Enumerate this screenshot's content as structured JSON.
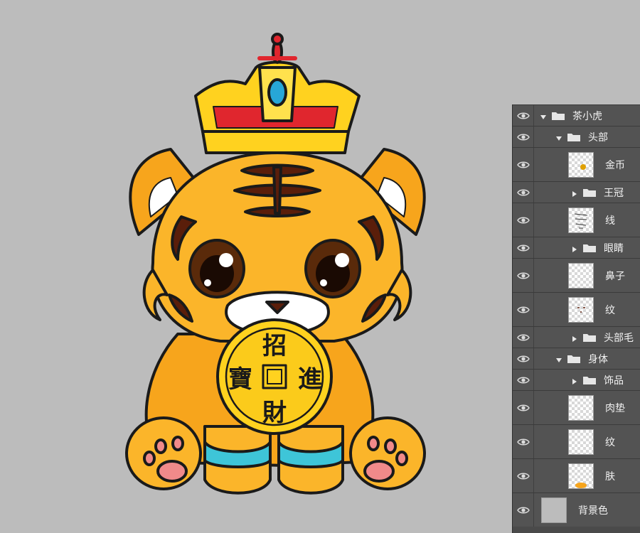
{
  "canvas": {
    "background_color": "#bcbcbc",
    "artwork": {
      "subject": "tiger cub wearing crown holding coin",
      "coin_text": {
        "top": "招",
        "bottom": "財",
        "left": "寶",
        "right": "進"
      }
    }
  },
  "layers_panel": {
    "layers": [
      {
        "label": "茶小虎",
        "type": "group",
        "expanded": true,
        "level": 0,
        "icon": "eye-icon"
      },
      {
        "label": "头部",
        "type": "group",
        "expanded": true,
        "level": 1,
        "icon": "eye-icon"
      },
      {
        "label": "金币",
        "type": "layer",
        "level": 2,
        "thumbnail": "coin-thumbnail"
      },
      {
        "label": "王冠",
        "type": "group",
        "expanded": false,
        "level": 2
      },
      {
        "label": "线",
        "type": "layer",
        "level": 2,
        "thumbnail": "lineart-thumbnail"
      },
      {
        "label": "眼睛",
        "type": "group",
        "expanded": false,
        "level": 2
      },
      {
        "label": "鼻子",
        "type": "layer",
        "level": 2,
        "thumbnail": "transparent-thumbnail"
      },
      {
        "label": "纹",
        "type": "layer",
        "level": 2,
        "thumbnail": "stripes-thumbnail"
      },
      {
        "label": "头部毛",
        "type": "group",
        "expanded": false,
        "level": 2
      },
      {
        "label": "身体",
        "type": "group",
        "expanded": true,
        "level": 1
      },
      {
        "label": "饰品",
        "type": "group",
        "expanded": false,
        "level": 2
      },
      {
        "label": "肉垫",
        "type": "layer",
        "level": 2,
        "thumbnail": "transparent-thumbnail"
      },
      {
        "label": "纹",
        "type": "layer",
        "level": 2,
        "thumbnail": "transparent-thumbnail"
      },
      {
        "label": "肤",
        "type": "layer",
        "level": 2,
        "thumbnail": "skin-thumbnail"
      },
      {
        "label": "背景色",
        "type": "layer",
        "level": 0,
        "thumbnail": "background-thumbnail"
      }
    ]
  },
  "colors": {
    "tiger_orange": "#f7a51c",
    "tiger_yellow": "#fdd23a",
    "stripe_brown": "#5a1e0a",
    "crown_gold": "#ffd21f",
    "crown_red": "#e0262e",
    "gem_blue": "#27a7d8",
    "paw_pink": "#f08a8a",
    "panel_bg": "#535353"
  }
}
